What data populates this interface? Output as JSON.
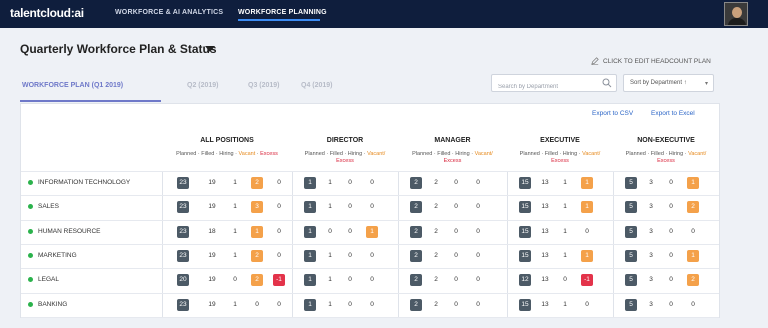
{
  "nav": {
    "logo": "talentcloud:ai",
    "items": [
      "WORKFORCE & AI ANALYTICS",
      "WORKFORCE PLANNING"
    ]
  },
  "header": {
    "title": "Quarterly Workforce Plan & Status",
    "edit_link": "CLICK TO EDIT HEADCOUNT PLAN"
  },
  "tabs": [
    "WORKFORCE PLAN (Q1 2019)",
    "Q2 (2019)",
    "Q3 (2019)",
    "Q4 (2019)"
  ],
  "search": {
    "placeholder": "Search by Department"
  },
  "sort": {
    "label": "Sort by Department ↑"
  },
  "export": {
    "csv": "Export to CSV",
    "excel": "Export to Excel"
  },
  "groups": [
    "ALL POSITIONS",
    "DIRECTOR",
    "MANAGER",
    "EXECUTIVE",
    "NON-EXECUTIVE"
  ],
  "subheader": {
    "planned": "Planned",
    "filled": "Filled",
    "hiring": "Hiring",
    "vacant": "Vacant/",
    "excess": "Excess",
    "sep": " · ",
    "vacant_single": "Vacant",
    "sep_dash": " · "
  },
  "rows": [
    {
      "dept": "INFORMATION TECHNOLOGY",
      "groups": [
        [
          23,
          19,
          1,
          2,
          0
        ],
        [
          1,
          1,
          0,
          0,
          null
        ],
        [
          2,
          2,
          0,
          0,
          null
        ],
        [
          15,
          13,
          1,
          1,
          null
        ],
        [
          5,
          3,
          0,
          1,
          null
        ]
      ]
    },
    {
      "dept": "SALES",
      "groups": [
        [
          23,
          19,
          1,
          3,
          0
        ],
        [
          1,
          1,
          0,
          0,
          null
        ],
        [
          2,
          2,
          0,
          0,
          null
        ],
        [
          15,
          13,
          1,
          1,
          null
        ],
        [
          5,
          3,
          0,
          2,
          null
        ]
      ]
    },
    {
      "dept": "HUMAN RESOURCE",
      "groups": [
        [
          23,
          18,
          1,
          1,
          0
        ],
        [
          1,
          0,
          0,
          1,
          null
        ],
        [
          2,
          2,
          0,
          0,
          null
        ],
        [
          15,
          13,
          1,
          0,
          null
        ],
        [
          5,
          3,
          0,
          0,
          null
        ]
      ]
    },
    {
      "dept": "MARKETING",
      "groups": [
        [
          23,
          19,
          1,
          2,
          0
        ],
        [
          1,
          1,
          0,
          0,
          null
        ],
        [
          2,
          2,
          0,
          0,
          null
        ],
        [
          15,
          13,
          1,
          1,
          null
        ],
        [
          5,
          3,
          0,
          1,
          null
        ]
      ]
    },
    {
      "dept": "LEGAL",
      "groups": [
        [
          20,
          19,
          0,
          2,
          -1
        ],
        [
          1,
          1,
          0,
          0,
          null
        ],
        [
          2,
          2,
          0,
          0,
          null
        ],
        [
          12,
          13,
          0,
          -1,
          null
        ],
        [
          5,
          3,
          0,
          2,
          null
        ]
      ]
    },
    {
      "dept": "BANKING",
      "groups": [
        [
          23,
          19,
          1,
          0,
          0
        ],
        [
          1,
          1,
          0,
          0,
          null
        ],
        [
          2,
          2,
          0,
          0,
          null
        ],
        [
          15,
          13,
          1,
          0,
          null
        ],
        [
          5,
          3,
          0,
          0,
          null
        ]
      ]
    }
  ],
  "colors": {
    "nav_bg": "#0f1e3d",
    "accent": "#6f79c9",
    "planned": "#4c5a66",
    "vacant": "#f4a14a",
    "excess": "#e3334a",
    "status_dot": "#2bb24c"
  }
}
